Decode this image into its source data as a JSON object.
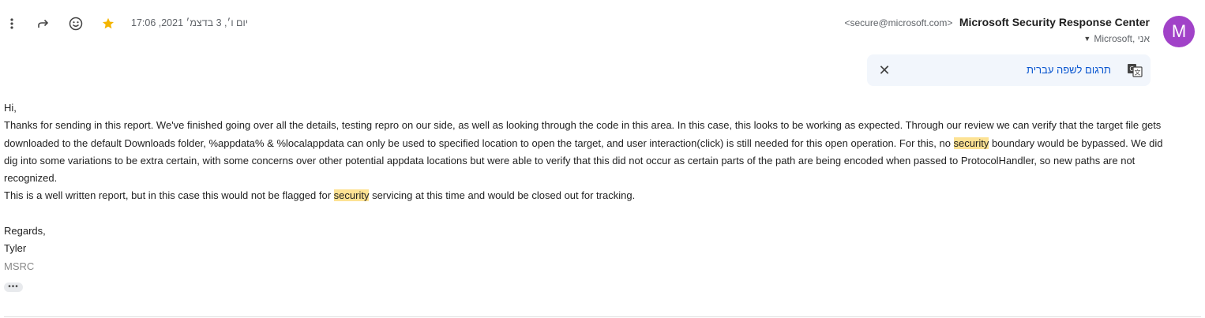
{
  "header": {
    "date": "יום ו׳, 3 בדצמ׳ 2021, 17:06",
    "sender_name": "Microsoft Security Response Center",
    "sender_email": "<secure@microsoft.com>",
    "recipients": "Microsoft, אני",
    "avatar_letter": "M",
    "avatar_color": "#a142c8",
    "star_color": "#f4b400"
  },
  "translate": {
    "link": "תרגום לשפה עברית"
  },
  "email": {
    "greeting": "Hi,",
    "p1_a": "Thanks for sending in this report.  We've finished going over all the details, testing repro on our side, as well as looking through the code in this area.  In this case, this looks to be working as expected.  Through our review we can verify that the target file gets downloaded to the default Downloads folder, %appdata% & %localappdata can only be used to specified location to open the target, and user interaction(click) is still needed for this open operation. For this, no ",
    "hl1": "security",
    "p1_b": " boundary would be bypassed. We did dig into some variations to be extra certain, with some concerns over other potential appdata locations but were able to verify that this did not occur as certain parts of the path are being encoded when passed to ProtocolHandler, so new paths are not recognized.",
    "p2_a": "This is a well written report, but in this case this would not be flagged for ",
    "hl2": "security",
    "p2_b": " servicing at this time and would be closed out for tracking.",
    "regards": "Regards,",
    "signer": "Tyler",
    "org": "MSRC",
    "more": "•••"
  }
}
